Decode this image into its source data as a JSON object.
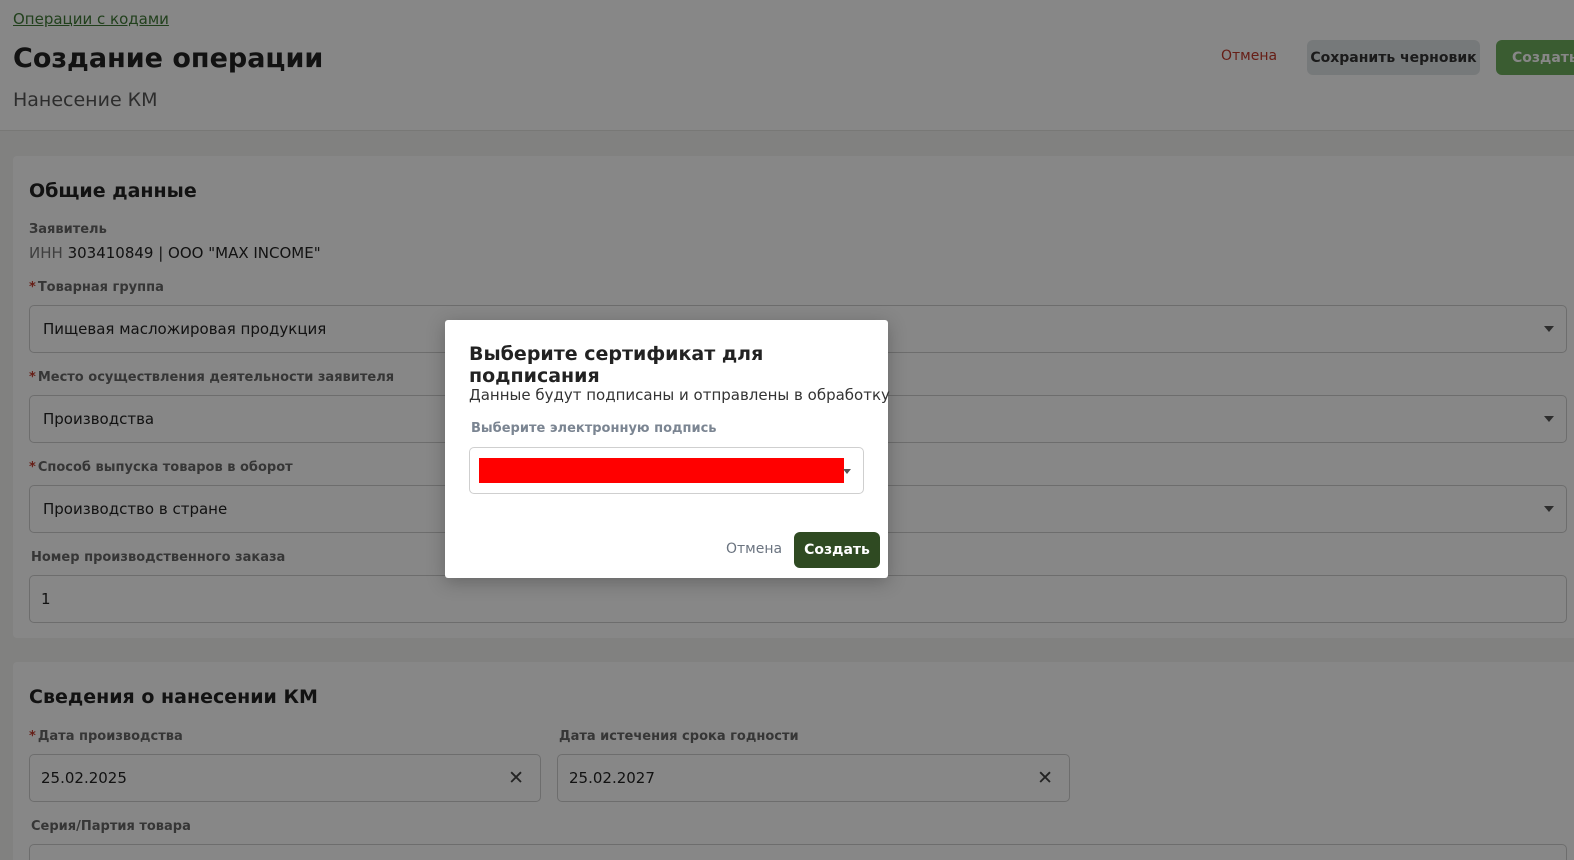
{
  "header": {
    "breadcrumb": "Операции с кодами",
    "title": "Создание операции",
    "subtitle": "Нанесение КМ",
    "cancel_label": "Отмена",
    "save_draft_label": "Сохранить черновик",
    "create_label": "Создать"
  },
  "general": {
    "title": "Общие данные",
    "applicant_label": "Заявитель",
    "applicant_inn_prefix": "ИНН",
    "applicant_value": "303410849 | ООО \"MAX INCOME\"",
    "required_mark": "*",
    "product_group_label": "Товарная группа",
    "product_group_value": "Пищевая масложировая продукция",
    "activity_place_label": "Место осуществления деятельности заявителя",
    "activity_place_value": "Производства",
    "release_method_label": "Способ выпуска товаров в оборот",
    "release_method_value": "Производство в стране",
    "order_number_label": "Номер производственного заказа",
    "order_number_value": "1"
  },
  "application": {
    "title": "Сведения о нанесении КМ",
    "production_date_label": "Дата производства",
    "production_date_value": "25.02.2025",
    "expiry_date_label": "Дата истечения срока годности",
    "expiry_date_value": "25.02.2027",
    "batch_label": "Серия/Партия товара"
  },
  "modal": {
    "title": "Выберите сертификат для подписания",
    "description": "Данные будут подписаны и отправлены в обработку",
    "signature_label": "Выберите электронную подпись",
    "cancel_label": "Отмена",
    "create_label": "Создать"
  },
  "colors": {
    "brand_green": "#6fae5e",
    "dark_green": "#2f4a22",
    "danger_red": "#c0392b",
    "redaction": "#ff0000"
  }
}
